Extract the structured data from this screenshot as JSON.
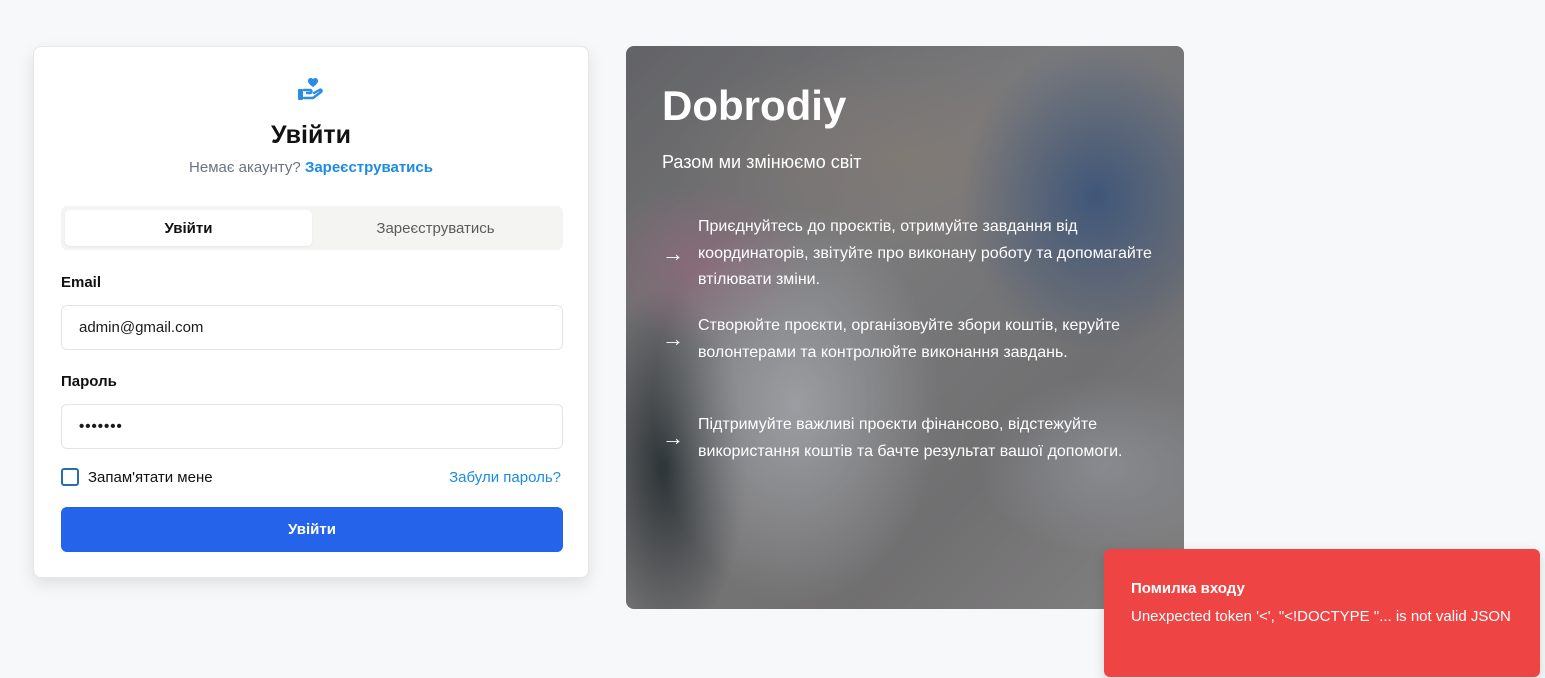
{
  "login": {
    "title": "Увійти",
    "no_account_text": "Немає акаунту?",
    "register_link": "Зареєструватись",
    "tabs": [
      {
        "label": "Увійти",
        "active": true
      },
      {
        "label": "Зареєструватись",
        "active": false
      }
    ],
    "email_label": "Email",
    "email_value": "admin@gmail.com",
    "password_label": "Пароль",
    "password_value": "•••••••",
    "remember_label": "Запам'ятати мене",
    "remember_checked": false,
    "forgot_link": "Забули пароль?",
    "submit_label": "Увійти"
  },
  "hero": {
    "title": "Dobrodiy",
    "subtitle": "Разом ми змінюємо світ",
    "features": [
      "Приєднуйтесь до проєктів, отримуйте завдання від координаторів, звітуйте про виконану роботу та допомагайте втілювати зміни.",
      "Створюйте проєкти, організовуйте збори коштів, керуйте волонтерами та контролюйте виконання завдань.",
      "Підтримуйте важливі проєкти фінансово, відстежуйте використання коштів та бачте результат вашої допомоги."
    ]
  },
  "toast": {
    "title": "Помилка входу",
    "message": "Unexpected token '<', \"<!DOCTYPE \"... is not valid JSON"
  },
  "colors": {
    "primary": "#2563eb",
    "link": "#1d8be0",
    "error": "#ef4444"
  },
  "icons": {
    "logo": "hand-heart-icon",
    "feature_bullet": "arrow-right-icon"
  }
}
